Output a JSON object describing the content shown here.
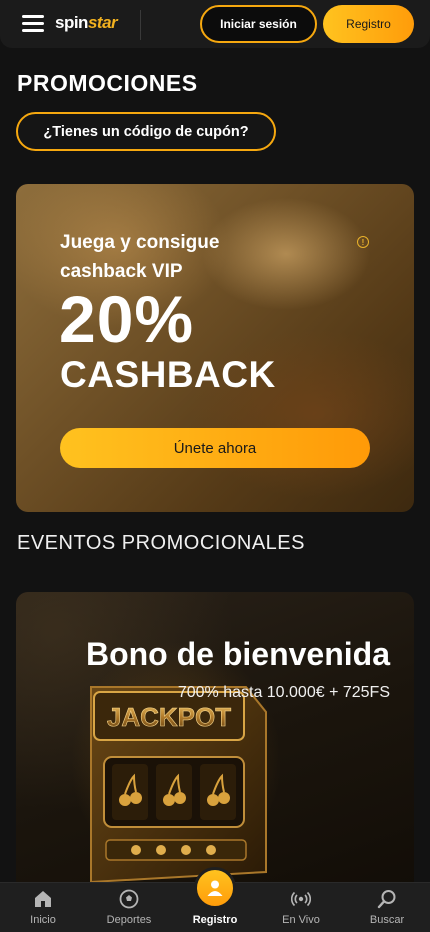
{
  "header": {
    "logo_primary": "spin",
    "logo_accent": "star",
    "login_label": "Iniciar sesión",
    "register_label": "Registro"
  },
  "page": {
    "title": "PROMOCIONES",
    "coupon_label": "¿Tienes un código de cupón?"
  },
  "promo": {
    "subtitle": "Juega y consigue cashback VIP",
    "headline": "20%",
    "headline_2": "CASHBACK",
    "cta_label": "Únete ahora",
    "info_glyph": "!"
  },
  "events": {
    "section_title": "EVENTOS PROMOCIONALES",
    "card_title": "Bono de bienvenida",
    "card_subtitle": "700% hasta 10.000€ + 725FS",
    "art_text": "JACKPOT"
  },
  "nav": {
    "items": [
      {
        "label": "Inicio",
        "icon": "home-icon"
      },
      {
        "label": "Deportes",
        "icon": "soccer-ball-icon"
      },
      {
        "label": "Registro",
        "icon": "user-icon"
      },
      {
        "label": "En Vivo",
        "icon": "live-broadcast-icon"
      },
      {
        "label": "Buscar",
        "icon": "search-icon"
      }
    ],
    "active_index": 2
  },
  "colors": {
    "accent": "#f6a80f",
    "accent_light": "#ffc31f",
    "background": "#121212"
  }
}
